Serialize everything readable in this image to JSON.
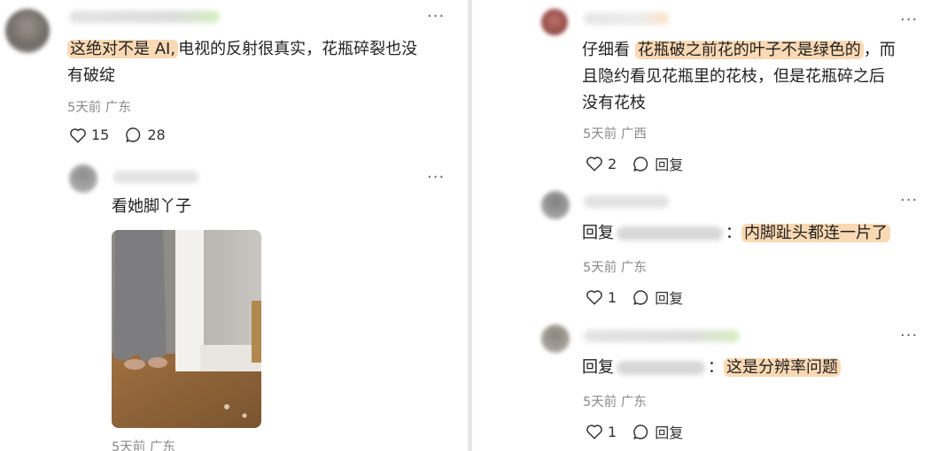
{
  "left": {
    "comment": {
      "text_highlight": "这绝对不是 AI,",
      "text_rest": "电视的反射很真实，花瓶碎裂也没",
      "text_line2": "有破绽",
      "meta": "5天前 广东",
      "like_count": "15",
      "comment_count": "28"
    },
    "reply": {
      "text": "看她脚丫子",
      "meta": "5天前 广东"
    }
  },
  "right": {
    "comment": {
      "text_prefix": "仔细看 ",
      "text_highlight": "花瓶破之前花的叶子不是绿色的",
      "text_suffix": "，而",
      "text_line2": "且隐约看见花瓶里的花枝，但是花瓶碎之后",
      "text_line3": "没有花枝",
      "meta": "5天前 广西",
      "like_count": "2",
      "reply_label": "回复"
    },
    "reply1": {
      "prefix": "回复",
      "colon": "：",
      "highlight": "内脚趾头都连一片了",
      "meta": "5天前 广东",
      "like_count": "1",
      "reply_label": "回复"
    },
    "reply2": {
      "prefix": "回复",
      "colon": "：",
      "highlight": "这是分辨率问题",
      "meta": "5天前 广东",
      "like_count": "1",
      "reply_label": "回复"
    }
  },
  "icons": {
    "more": "more-icon",
    "like": "heart-icon",
    "comment": "comment-bubble-icon"
  },
  "colors": {
    "highlight": "#fbd9b4",
    "meta": "#8a8a8a",
    "divider": "#e6e6e6"
  }
}
